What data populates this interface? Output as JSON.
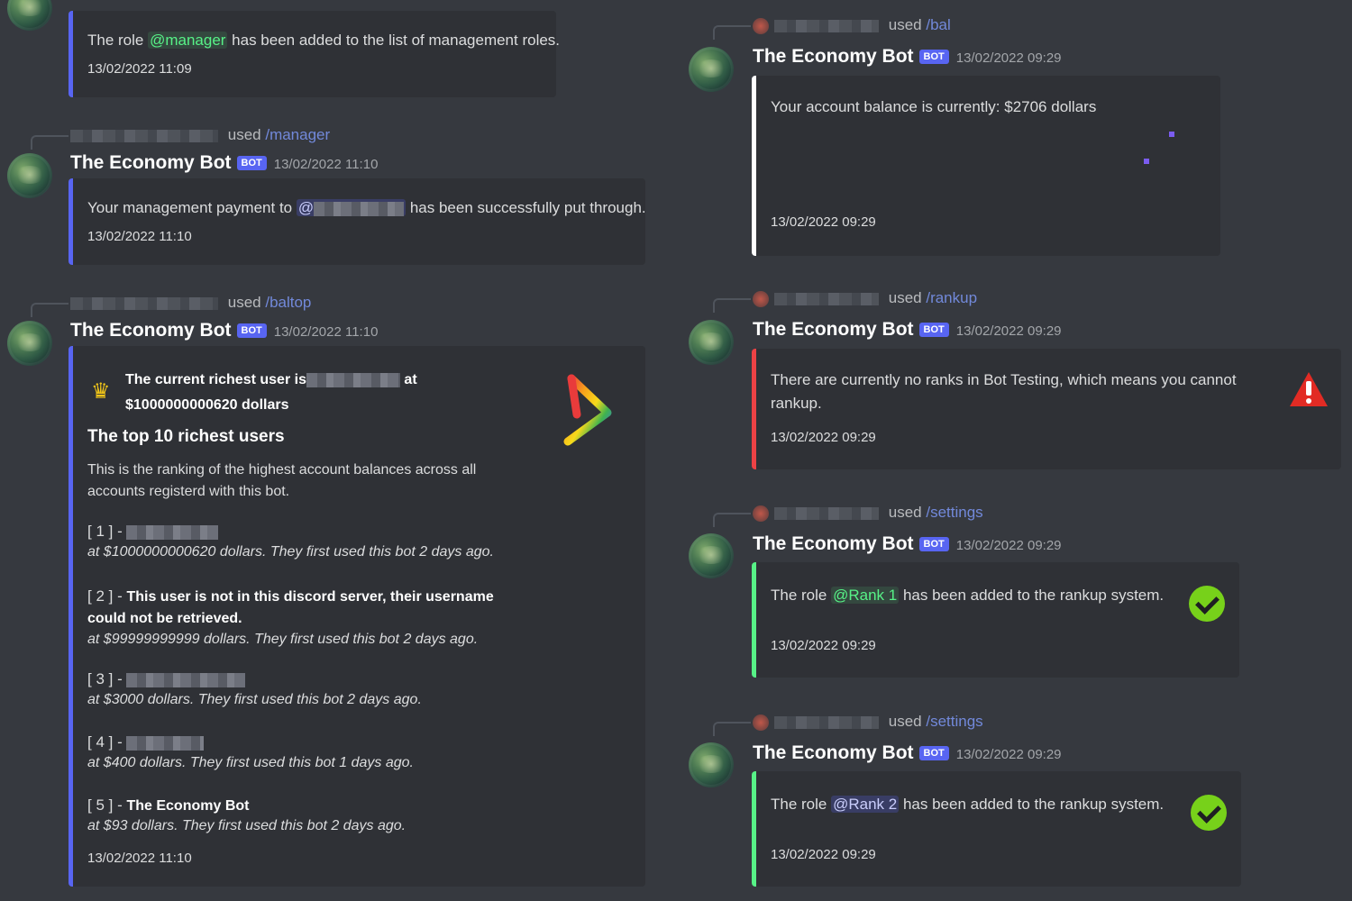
{
  "bot": {
    "name": "The Economy Bot",
    "tag": "BOT"
  },
  "left": {
    "msg0": {
      "embed_text_pre": "The role ",
      "mention": "@manager",
      "embed_text_post": " has been added to the list of management roles.",
      "footer": "13/02/2022 11:09"
    },
    "msg1": {
      "reply_used": "used",
      "reply_cmd": "/manager",
      "timestamp": "13/02/2022 11:10",
      "embed_text_pre": "Your management payment to ",
      "mention": "@",
      "embed_text_post": " has been successfully put through.",
      "footer": "13/02/2022 11:10"
    },
    "msg2": {
      "reply_used": "used",
      "reply_cmd": "/baltop",
      "timestamp": "13/02/2022 11:10",
      "richest_pre": "The current richest user is",
      "richest_at": "at",
      "richest_amount": "$1000000000620 dollars",
      "title": "The top 10 richest users",
      "description": "This is the ranking of the highest account balances across all accounts registerd with this bot.",
      "ranks": [
        {
          "num": "[ 1 ] - ",
          "name": "",
          "detail": "at $1000000000620 dollars. They first used this bot 2 days ago."
        },
        {
          "num": "[ 2 ] - ",
          "name": "This user is not in this discord server, their username could not be retrieved.",
          "detail": "at $99999999999 dollars. They first used this bot 2 days ago."
        },
        {
          "num": "[ 3 ] - ",
          "name": "",
          "detail": "at $3000 dollars. They first used this bot 2 days ago."
        },
        {
          "num": "[ 4 ] - ",
          "name": "",
          "detail": "at $400 dollars. They first used this bot 1 days ago."
        },
        {
          "num": "[ 5 ] - ",
          "name": "The Economy Bot",
          "detail": "at $93 dollars. They first used this bot 2 days ago."
        }
      ],
      "footer": "13/02/2022 11:10"
    }
  },
  "right": {
    "msg0": {
      "reply_used": "used",
      "reply_cmd": "/bal",
      "timestamp": "13/02/2022 09:29",
      "embed_text": "Your account balance is currently: $2706 dollars",
      "footer": "13/02/2022 09:29"
    },
    "msg1": {
      "reply_used": "used",
      "reply_cmd": "/rankup",
      "timestamp": "13/02/2022 09:29",
      "embed_text": "There are currently no ranks in Bot Testing, which means you cannot rankup.",
      "footer": "13/02/2022 09:29"
    },
    "msg2": {
      "reply_used": "used",
      "reply_cmd": "/settings",
      "timestamp": "13/02/2022 09:29",
      "embed_text_pre": "The role ",
      "mention": "@Rank 1",
      "embed_text_post": " has been added to the rankup system.",
      "footer": "13/02/2022 09:29"
    },
    "msg3": {
      "reply_used": "used",
      "reply_cmd": "/settings",
      "timestamp": "13/02/2022 09:29",
      "embed_text_pre": "The role ",
      "mention": "@Rank 2",
      "embed_text_post": " has been added to the rankup system.",
      "footer": "13/02/2022 09:29"
    }
  },
  "colors": {
    "background": "#36393f",
    "embed_bg": "#2f3136",
    "blurple": "#5865f2",
    "white_bar": "#ffffff",
    "red_bar": "#ed4245",
    "green_bar": "#57f287"
  },
  "icons": [
    "check-icon",
    "warning-icon",
    "crown-icon",
    "rainbow-logo-icon"
  ]
}
